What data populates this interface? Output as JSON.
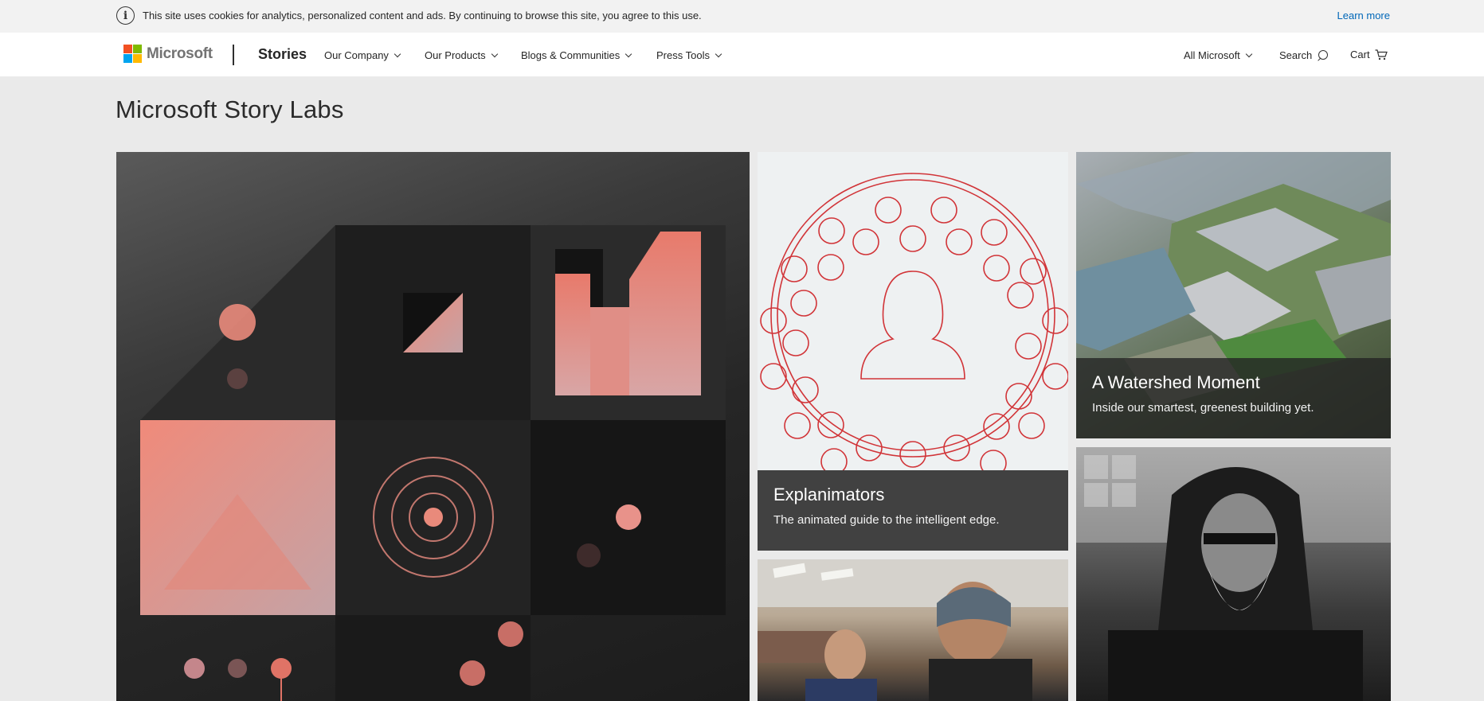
{
  "cookie_banner": {
    "message": "This site uses cookies for analytics, personalized content and ads. By continuing to browse this site, you agree to this use.",
    "learn_more": "Learn more"
  },
  "header": {
    "brand": "Microsoft",
    "section": "Stories",
    "nav": [
      "Our Company",
      "Our Products",
      "Blogs & Communities",
      "Press Tools"
    ],
    "all_microsoft": "All Microsoft",
    "search": "Search",
    "cart": "Cart"
  },
  "page": {
    "title": "Microsoft Story Labs"
  },
  "tiles": {
    "explainimators": {
      "title": "Explanimators",
      "subtitle": "The animated guide to the intelligent edge."
    },
    "watershed": {
      "title": "A Watershed Moment",
      "subtitle": "Inside our smartest, greenest building yet."
    }
  },
  "colors": {
    "accent": "#0067b8",
    "salmon": "#e98a7b",
    "icon_red": "#d13438",
    "logo_red": "#f25022",
    "logo_green": "#7fba00",
    "logo_blue": "#00a4ef",
    "logo_yellow": "#ffb900"
  }
}
